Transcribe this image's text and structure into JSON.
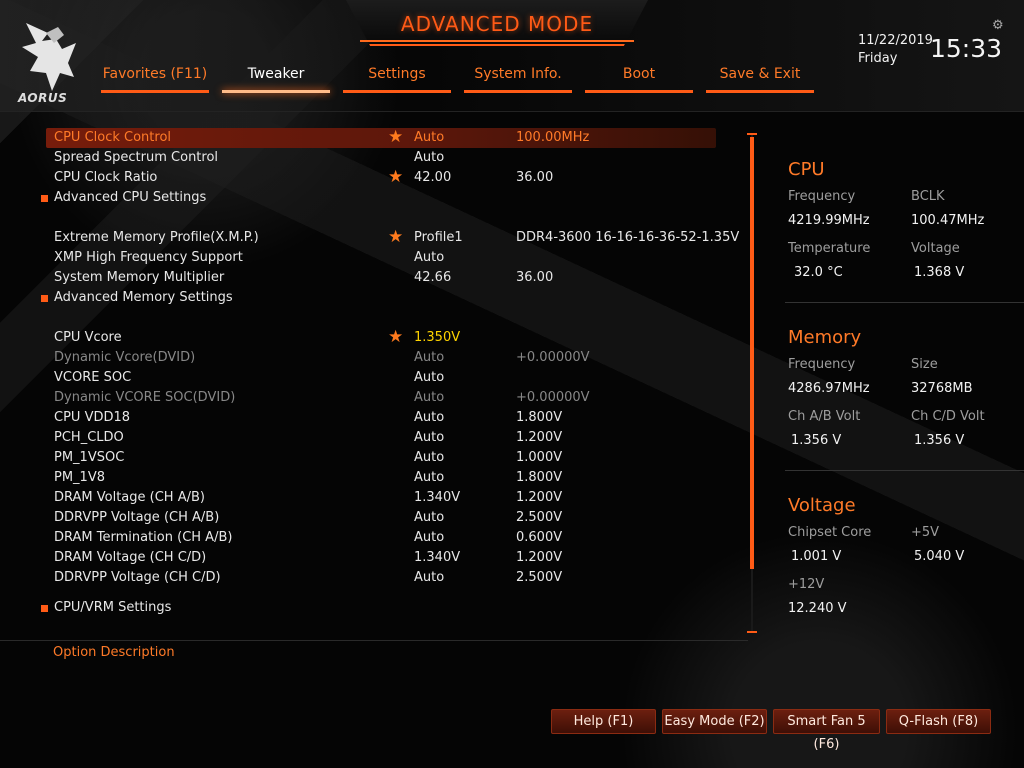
{
  "header": {
    "title": "ADVANCED MODE",
    "logo_text": "AORUS",
    "date": "11/22/2019",
    "day": "Friday",
    "time": "15:33",
    "settings_icon": "gear-icon"
  },
  "tabs": [
    {
      "label": "Favorites (F11)"
    },
    {
      "label": "Tweaker"
    },
    {
      "label": "Settings"
    },
    {
      "label": "System Info."
    },
    {
      "label": "Boot"
    },
    {
      "label": "Save & Exit"
    }
  ],
  "active_tab": "Tweaker",
  "settings": [
    {
      "label": "CPU Clock Control",
      "value1": "Auto",
      "value2": "100.00MHz",
      "favorite": true,
      "selected": true,
      "dim": false,
      "submenu": false
    },
    {
      "label": "Spread Spectrum Control",
      "value1": "Auto",
      "value2": "",
      "favorite": false,
      "selected": false,
      "dim": false,
      "submenu": false
    },
    {
      "label": "CPU Clock Ratio",
      "value1": "42.00",
      "value2": "36.00",
      "favorite": true,
      "selected": false,
      "dim": false,
      "submenu": false
    },
    {
      "label": "Advanced CPU Settings",
      "value1": "",
      "value2": "",
      "favorite": false,
      "selected": false,
      "dim": false,
      "submenu": true
    },
    {
      "label": "Extreme Memory Profile(X.M.P.)",
      "value1": "Profile1",
      "value2": "DDR4-3600 16-16-16-36-52-1.35V",
      "favorite": true,
      "selected": false,
      "dim": false,
      "submenu": false
    },
    {
      "label": "XMP High Frequency Support",
      "value1": "Auto",
      "value2": "",
      "favorite": false,
      "selected": false,
      "dim": false,
      "submenu": false
    },
    {
      "label": "System Memory Multiplier",
      "value1": "42.66",
      "value2": "36.00",
      "favorite": false,
      "selected": false,
      "dim": false,
      "submenu": false
    },
    {
      "label": "Advanced Memory Settings",
      "value1": "",
      "value2": "",
      "favorite": false,
      "selected": false,
      "dim": false,
      "submenu": true
    },
    {
      "label": "CPU Vcore",
      "value1": "1.350V",
      "value2": "",
      "favorite": true,
      "selected": false,
      "dim": false,
      "submenu": false,
      "highlight": "yellow"
    },
    {
      "label": "Dynamic Vcore(DVID)",
      "value1": "Auto",
      "value2": "+0.00000V",
      "favorite": false,
      "selected": false,
      "dim": true,
      "submenu": false
    },
    {
      "label": "VCORE SOC",
      "value1": "Auto",
      "value2": "",
      "favorite": false,
      "selected": false,
      "dim": false,
      "submenu": false
    },
    {
      "label": "Dynamic VCORE SOC(DVID)",
      "value1": "Auto",
      "value2": "+0.00000V",
      "favorite": false,
      "selected": false,
      "dim": true,
      "submenu": false
    },
    {
      "label": "CPU VDD18",
      "value1": "Auto",
      "value2": "1.800V",
      "favorite": false,
      "selected": false,
      "dim": false,
      "submenu": false
    },
    {
      "label": "PCH_CLDO",
      "value1": "Auto",
      "value2": "1.200V",
      "favorite": false,
      "selected": false,
      "dim": false,
      "submenu": false
    },
    {
      "label": "PM_1VSOC",
      "value1": "Auto",
      "value2": "1.000V",
      "favorite": false,
      "selected": false,
      "dim": false,
      "submenu": false
    },
    {
      "label": "PM_1V8",
      "value1": "Auto",
      "value2": "1.800V",
      "favorite": false,
      "selected": false,
      "dim": false,
      "submenu": false
    },
    {
      "label": "DRAM Voltage    (CH A/B)",
      "value1": "1.340V",
      "value2": "1.200V",
      "favorite": false,
      "selected": false,
      "dim": false,
      "submenu": false
    },
    {
      "label": "DDRVPP Voltage  (CH A/B)",
      "value1": "Auto",
      "value2": "2.500V",
      "favorite": false,
      "selected": false,
      "dim": false,
      "submenu": false
    },
    {
      "label": "DRAM Termination  (CH A/B)",
      "value1": "Auto",
      "value2": "0.600V",
      "favorite": false,
      "selected": false,
      "dim": false,
      "submenu": false
    },
    {
      "label": "DRAM Voltage    (CH C/D)",
      "value1": "1.340V",
      "value2": "1.200V",
      "favorite": false,
      "selected": false,
      "dim": false,
      "submenu": false
    },
    {
      "label": "DDRVPP Voltage  (CH C/D)",
      "value1": "Auto",
      "value2": "2.500V",
      "favorite": false,
      "selected": false,
      "dim": false,
      "submenu": false
    },
    {
      "label": "CPU/VRM Settings",
      "value1": "",
      "value2": "",
      "favorite": false,
      "selected": false,
      "dim": false,
      "submenu": true
    }
  ],
  "cpu": {
    "title": "CPU",
    "frequency_label": "Frequency",
    "bclk_label": "BCLK",
    "frequency": "4219.99MHz",
    "bclk": "100.47MHz",
    "temperature_label": "Temperature",
    "voltage_label": "Voltage",
    "temperature": "32.0 °C",
    "voltage": "1.368 V"
  },
  "memory": {
    "title": "Memory",
    "frequency_label": "Frequency",
    "size_label": "Size",
    "frequency": "4286.97MHz",
    "size": "32768MB",
    "ch_ab_label": "Ch A/B Volt",
    "ch_cd_label": "Ch C/D Volt",
    "ch_ab": "1.356 V",
    "ch_cd": "1.356 V"
  },
  "voltage": {
    "title": "Voltage",
    "chipset_core_label": "Chipset Core",
    "plus5_label": "+5V",
    "chipset_core": "1.001 V",
    "plus5": "5.040 V",
    "plus12_label": "+12V",
    "plus12": "12.240 V"
  },
  "option_description": "Option Description",
  "footer_buttons": [
    {
      "label": "Help (F1)"
    },
    {
      "label": "Easy Mode (F2)"
    },
    {
      "label": "Smart Fan 5 (F6)"
    },
    {
      "label": "Q-Flash (F8)"
    }
  ],
  "colors": {
    "accent": "#ff5b16",
    "highlight": "#ffd400"
  }
}
